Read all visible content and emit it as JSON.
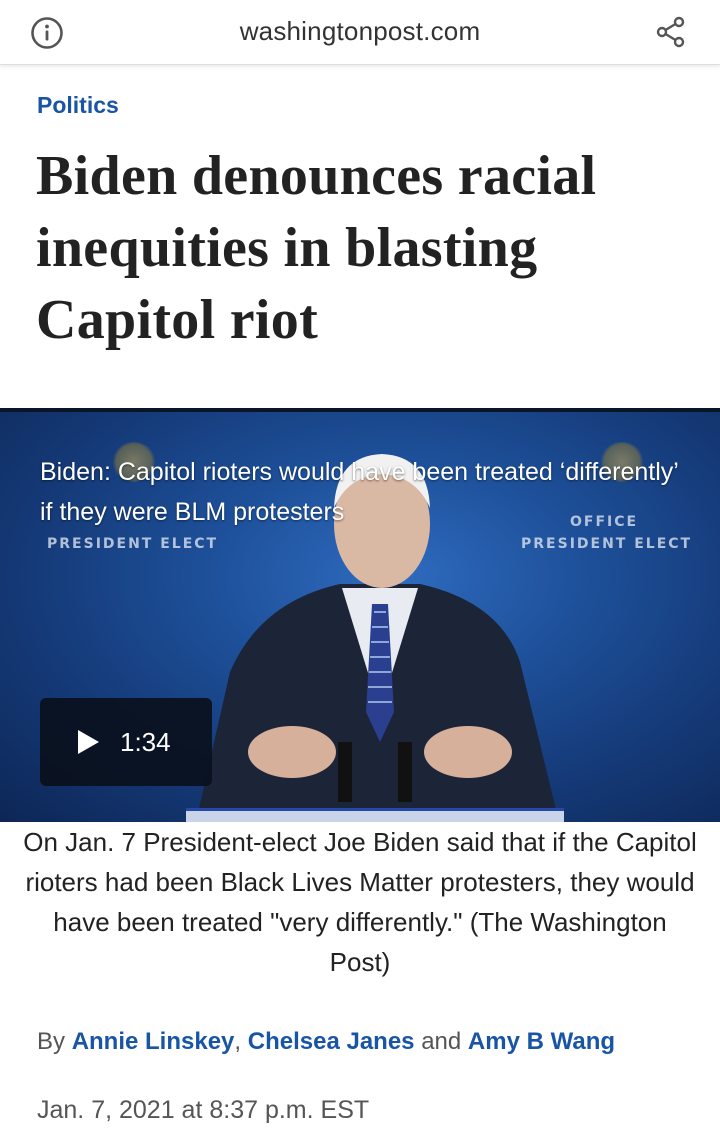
{
  "browser": {
    "url": "washingtonpost.com",
    "info_icon": "info-icon",
    "share_icon": "share-icon"
  },
  "article": {
    "section": "Politics",
    "headline": "Biden denounces racial inequities in blasting Capitol riot",
    "video": {
      "overlay_caption": "Biden: Capitol rioters would have been treated ‘differently’ if they were BLM protesters",
      "podium_text_left": "PRESIDENT ELECT",
      "podium_text_right": "PRESIDENT ELECT",
      "podium_text_office": "OFFICE",
      "duration": "1:34",
      "play_icon": "play-icon"
    },
    "video_description": "On Jan. 7 President-elect Joe Biden said that if the Capitol rioters had been Black Lives Matter protesters, they would have been treated \"very differently.\" (The Washington Post)",
    "byline": {
      "prefix": "By",
      "authors": [
        "Annie Linskey",
        "Chelsea Janes",
        "Amy B Wang"
      ],
      "separator": ",",
      "conjunction": "and"
    },
    "date": "Jan. 7, 2021 at 8:37 p.m. EST"
  },
  "colors": {
    "link_blue": "#1955a5",
    "headline": "#222222",
    "video_bg": "#1d4f98"
  }
}
